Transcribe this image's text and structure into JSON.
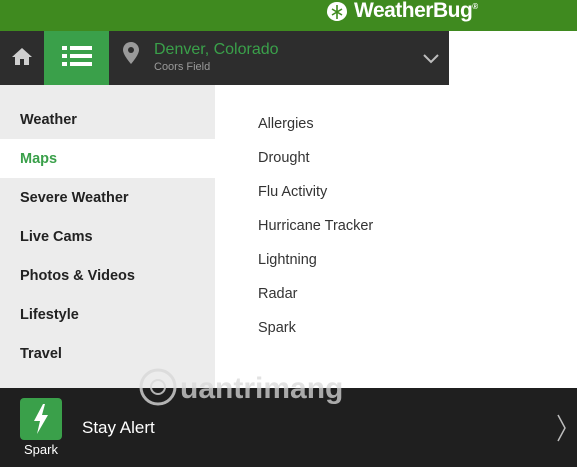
{
  "header": {
    "brand": "WeatherBug",
    "brand_mark": "®"
  },
  "nav": {
    "home_icon": "home-icon",
    "menu_icon": "list-menu-icon",
    "location": {
      "city": "Denver,",
      "state": "Colorado",
      "place": "Coors Field"
    }
  },
  "sidebar": {
    "items": [
      {
        "label": "Weather"
      },
      {
        "label": "Maps"
      },
      {
        "label": "Severe Weather"
      },
      {
        "label": "Live Cams"
      },
      {
        "label": "Photos & Videos"
      },
      {
        "label": "Lifestyle"
      },
      {
        "label": "Travel"
      }
    ],
    "active": "Maps"
  },
  "submenu": {
    "items": [
      {
        "label": "Allergies"
      },
      {
        "label": "Drought"
      },
      {
        "label": "Flu Activity"
      },
      {
        "label": "Hurricane Tracker"
      },
      {
        "label": "Lightning"
      },
      {
        "label": "Radar"
      },
      {
        "label": "Spark"
      }
    ]
  },
  "bottom": {
    "spark_label": "Spark",
    "alert_text": "Stay Alert"
  },
  "colors": {
    "brand_green": "#3f8a1f",
    "accent_green": "#3aa04a",
    "dark": "#1f1f1f"
  }
}
